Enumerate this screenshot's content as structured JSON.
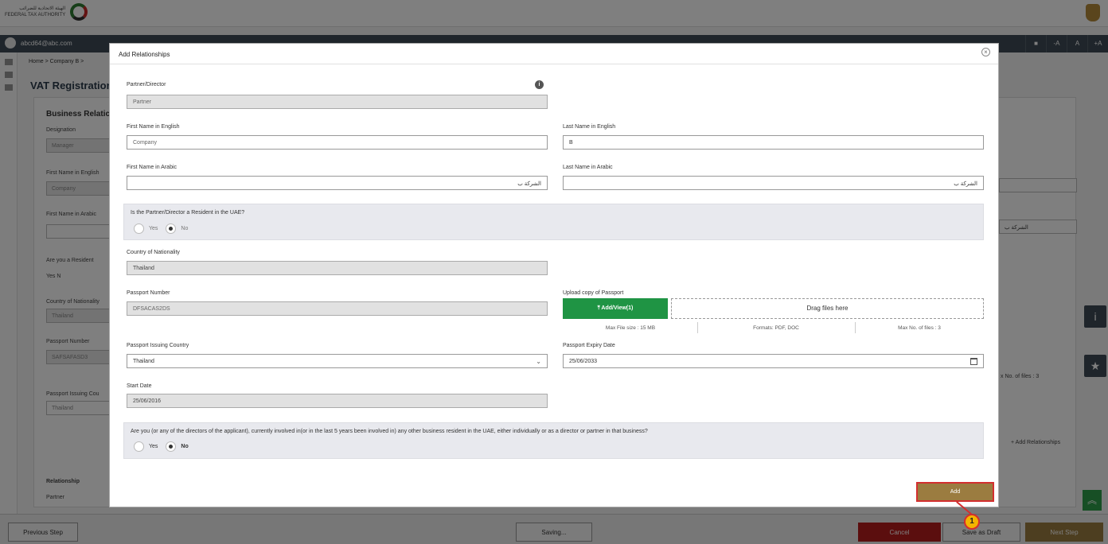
{
  "app": {
    "logo_ar": "الهيئة الاتحادية للضرائب",
    "logo_en": "FEDERAL TAX AUTHORITY",
    "user_email": "abcd64@abc.com",
    "font_size_buttons": [
      "-A",
      "A",
      "+A"
    ]
  },
  "background": {
    "breadcrumb": "Home  >  Company B  >",
    "page_title": "VAT Registration -",
    "section_title": "Business Relatic",
    "designation_label": "Designation",
    "designation_value": "Manager",
    "first_name_en_label": "First Name in English",
    "first_name_en_value": "Company",
    "first_name_ar_label": "First Name in Arabic",
    "resident_label": "Are you a Resident",
    "resident_yes": "Yes",
    "resident_no": "N",
    "nationality_label": "Country of Nationality",
    "nationality_value": "Thailand",
    "passport_label": "Passport Number",
    "passport_value": "SAFSAFASD3",
    "issuing_label": "Passport Issuing Cou",
    "issuing_value": "Thailand",
    "relationship_header": "Relationship",
    "relationship_value": "Partner",
    "right_arabic_value": "الشركة ب",
    "max_files": "x No. of files : 3",
    "add_relationships": "Add Relationships"
  },
  "footer": {
    "previous": "Previous Step",
    "saving": "Saving...",
    "cancel": "Cancel",
    "save_draft": "Save as Draft",
    "next": "Next Step"
  },
  "modal": {
    "title": "Add Relationships",
    "partner_director_label": "Partner/Director",
    "partner_director_value": "Partner",
    "first_name_en_label": "First Name in English",
    "first_name_en_value": "Company",
    "last_name_en_label": "Last Name in English",
    "last_name_en_value": "B",
    "first_name_ar_label": "First Name in Arabic",
    "first_name_ar_value": "الشركة ب",
    "last_name_ar_label": "Last Name in Arabic",
    "last_name_ar_value": "الشركة ب",
    "resident_question": "Is the Partner/Director a Resident in the UAE?",
    "resident_yes": "Yes",
    "resident_no": "No",
    "nationality_label": "Country of Nationality",
    "nationality_value": "Thailand",
    "passport_label": "Passport Number",
    "passport_value": "DFSACAS2DS",
    "upload_label": "Upload copy of Passport",
    "upload_button": "Add/View(1)",
    "dropzone_text": "Drag files here",
    "max_file_size": "Max File size : 15 MB",
    "formats": "Formats: PDF, DOC",
    "max_files": "Max No. of files : 3",
    "issuing_country_label": "Passport Issuing Country",
    "issuing_country_value": "Thailand",
    "expiry_label": "Passport Expiry Date",
    "expiry_value": "25/06/2033",
    "start_date_label": "Start Date",
    "start_date_value": "25/06/2016",
    "business_question": "Are you (or any of the directors of the applicant), currently involved in(or in the last 5 years been involved in) any other business resident in the UAE, either individually or as a director or partner in that business?",
    "business_yes": "Yes",
    "business_no": "No",
    "add_button": "Add",
    "callout_number": "1"
  },
  "colors": {
    "green": "#1f9444",
    "gold": "#9b7c40",
    "red_highlight": "#d32f2f",
    "callout": "#f4b400",
    "cancel_red": "#b71c1c"
  }
}
